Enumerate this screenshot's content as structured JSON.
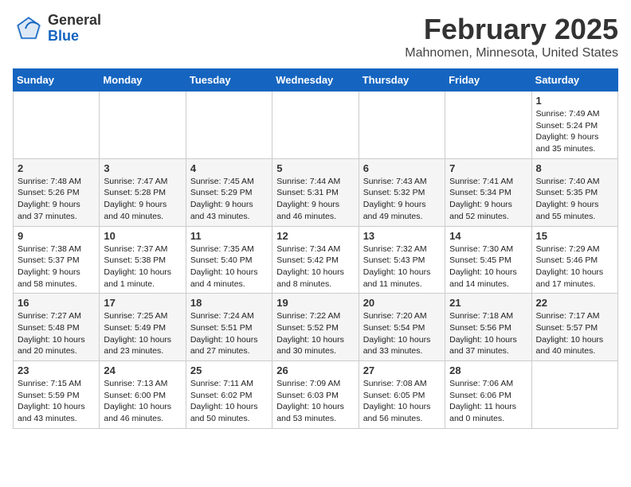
{
  "header": {
    "logo_general": "General",
    "logo_blue": "Blue",
    "month_title": "February 2025",
    "location": "Mahnomen, Minnesota, United States"
  },
  "calendar": {
    "days_of_week": [
      "Sunday",
      "Monday",
      "Tuesday",
      "Wednesday",
      "Thursday",
      "Friday",
      "Saturday"
    ],
    "weeks": [
      [
        {
          "day": "",
          "info": ""
        },
        {
          "day": "",
          "info": ""
        },
        {
          "day": "",
          "info": ""
        },
        {
          "day": "",
          "info": ""
        },
        {
          "day": "",
          "info": ""
        },
        {
          "day": "",
          "info": ""
        },
        {
          "day": "1",
          "info": "Sunrise: 7:49 AM\nSunset: 5:24 PM\nDaylight: 9 hours\nand 35 minutes."
        }
      ],
      [
        {
          "day": "2",
          "info": "Sunrise: 7:48 AM\nSunset: 5:26 PM\nDaylight: 9 hours\nand 37 minutes."
        },
        {
          "day": "3",
          "info": "Sunrise: 7:47 AM\nSunset: 5:28 PM\nDaylight: 9 hours\nand 40 minutes."
        },
        {
          "day": "4",
          "info": "Sunrise: 7:45 AM\nSunset: 5:29 PM\nDaylight: 9 hours\nand 43 minutes."
        },
        {
          "day": "5",
          "info": "Sunrise: 7:44 AM\nSunset: 5:31 PM\nDaylight: 9 hours\nand 46 minutes."
        },
        {
          "day": "6",
          "info": "Sunrise: 7:43 AM\nSunset: 5:32 PM\nDaylight: 9 hours\nand 49 minutes."
        },
        {
          "day": "7",
          "info": "Sunrise: 7:41 AM\nSunset: 5:34 PM\nDaylight: 9 hours\nand 52 minutes."
        },
        {
          "day": "8",
          "info": "Sunrise: 7:40 AM\nSunset: 5:35 PM\nDaylight: 9 hours\nand 55 minutes."
        }
      ],
      [
        {
          "day": "9",
          "info": "Sunrise: 7:38 AM\nSunset: 5:37 PM\nDaylight: 9 hours\nand 58 minutes."
        },
        {
          "day": "10",
          "info": "Sunrise: 7:37 AM\nSunset: 5:38 PM\nDaylight: 10 hours\nand 1 minute."
        },
        {
          "day": "11",
          "info": "Sunrise: 7:35 AM\nSunset: 5:40 PM\nDaylight: 10 hours\nand 4 minutes."
        },
        {
          "day": "12",
          "info": "Sunrise: 7:34 AM\nSunset: 5:42 PM\nDaylight: 10 hours\nand 8 minutes."
        },
        {
          "day": "13",
          "info": "Sunrise: 7:32 AM\nSunset: 5:43 PM\nDaylight: 10 hours\nand 11 minutes."
        },
        {
          "day": "14",
          "info": "Sunrise: 7:30 AM\nSunset: 5:45 PM\nDaylight: 10 hours\nand 14 minutes."
        },
        {
          "day": "15",
          "info": "Sunrise: 7:29 AM\nSunset: 5:46 PM\nDaylight: 10 hours\nand 17 minutes."
        }
      ],
      [
        {
          "day": "16",
          "info": "Sunrise: 7:27 AM\nSunset: 5:48 PM\nDaylight: 10 hours\nand 20 minutes."
        },
        {
          "day": "17",
          "info": "Sunrise: 7:25 AM\nSunset: 5:49 PM\nDaylight: 10 hours\nand 23 minutes."
        },
        {
          "day": "18",
          "info": "Sunrise: 7:24 AM\nSunset: 5:51 PM\nDaylight: 10 hours\nand 27 minutes."
        },
        {
          "day": "19",
          "info": "Sunrise: 7:22 AM\nSunset: 5:52 PM\nDaylight: 10 hours\nand 30 minutes."
        },
        {
          "day": "20",
          "info": "Sunrise: 7:20 AM\nSunset: 5:54 PM\nDaylight: 10 hours\nand 33 minutes."
        },
        {
          "day": "21",
          "info": "Sunrise: 7:18 AM\nSunset: 5:56 PM\nDaylight: 10 hours\nand 37 minutes."
        },
        {
          "day": "22",
          "info": "Sunrise: 7:17 AM\nSunset: 5:57 PM\nDaylight: 10 hours\nand 40 minutes."
        }
      ],
      [
        {
          "day": "23",
          "info": "Sunrise: 7:15 AM\nSunset: 5:59 PM\nDaylight: 10 hours\nand 43 minutes."
        },
        {
          "day": "24",
          "info": "Sunrise: 7:13 AM\nSunset: 6:00 PM\nDaylight: 10 hours\nand 46 minutes."
        },
        {
          "day": "25",
          "info": "Sunrise: 7:11 AM\nSunset: 6:02 PM\nDaylight: 10 hours\nand 50 minutes."
        },
        {
          "day": "26",
          "info": "Sunrise: 7:09 AM\nSunset: 6:03 PM\nDaylight: 10 hours\nand 53 minutes."
        },
        {
          "day": "27",
          "info": "Sunrise: 7:08 AM\nSunset: 6:05 PM\nDaylight: 10 hours\nand 56 minutes."
        },
        {
          "day": "28",
          "info": "Sunrise: 7:06 AM\nSunset: 6:06 PM\nDaylight: 11 hours\nand 0 minutes."
        },
        {
          "day": "",
          "info": ""
        }
      ]
    ]
  }
}
